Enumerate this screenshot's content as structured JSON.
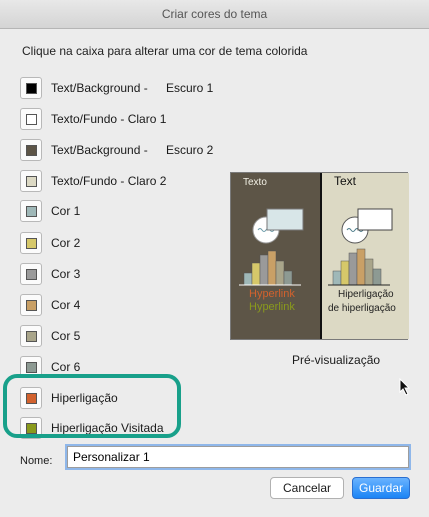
{
  "window": {
    "title": "Criar cores do tema"
  },
  "instruction": "Clique na caixa para alterar uma cor de tema colorida",
  "theme_colors": [
    {
      "label": "Text/Background -",
      "extra": "Escuro 1",
      "color": "#000000"
    },
    {
      "label": "Texto/Fundo - Claro 1",
      "extra": "",
      "color": "#ffffff"
    },
    {
      "label": "Text/Background -",
      "extra": "Escuro 2",
      "color": "#5d5547"
    },
    {
      "label": "Texto/Fundo - Claro 2",
      "extra": "",
      "color": "#dcd9c4"
    },
    {
      "label": "Cor 1",
      "extra": "",
      "color": "#9fb8b8"
    },
    {
      "label": "Cor 2",
      "extra": "",
      "color": "#d6c86a"
    },
    {
      "label": "Cor 3",
      "extra": "",
      "color": "#9a9a9a"
    },
    {
      "label": "Cor 4",
      "extra": "",
      "color": "#c9a066"
    },
    {
      "label": "Cor 5",
      "extra": "",
      "color": "#a9a58a"
    },
    {
      "label": "Cor 6",
      "extra": "",
      "color": "#8d9a93"
    },
    {
      "label": "Hiperligação",
      "extra": "",
      "color": "#d2622e"
    },
    {
      "label": "Hiperligação Visitada",
      "extra": "",
      "color": "#8a9a1c"
    }
  ],
  "preview": {
    "caption": "Pré-visualização",
    "left": {
      "text": "Texto",
      "hyperlink": "Hyperlink",
      "visited": "Hyperlink"
    },
    "right": {
      "text": "Text",
      "hyperlink": "Hiperligação",
      "visited": "de hiperligação"
    }
  },
  "name_field": {
    "label": "Nome:",
    "value": "Personalizar 1"
  },
  "buttons": {
    "cancel": "Cancelar",
    "save": "Guardar"
  },
  "colors": {
    "highlight": "#18a08a",
    "primary_button": "#1b84f5"
  }
}
